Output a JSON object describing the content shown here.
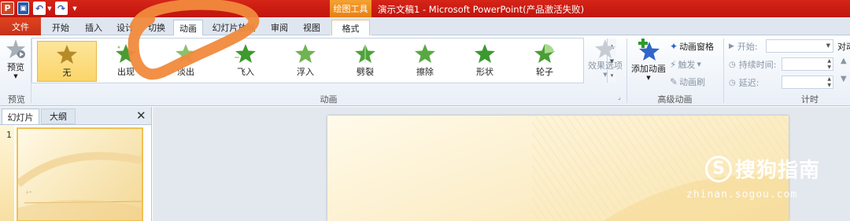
{
  "qat": {
    "app_logo": "P",
    "undo": "↶",
    "redo": "↷"
  },
  "window": {
    "contextual_group": "绘图工具",
    "title": "演示文稿1 - Microsoft PowerPoint(产品激活失败)"
  },
  "tabs": {
    "file": "文件",
    "items": [
      "开始",
      "插入",
      "设计",
      "切换",
      "动画",
      "幻灯片放映",
      "审阅",
      "视图"
    ],
    "active": "动画",
    "format": "格式"
  },
  "ribbon": {
    "preview": {
      "label": "预览",
      "group": "预览"
    },
    "animation_group": "动画",
    "gallery": [
      "无",
      "出现",
      "淡出",
      "飞入",
      "浮入",
      "劈裂",
      "擦除",
      "形状",
      "轮子"
    ],
    "selected": "无",
    "effect_options": "效果选项",
    "advanced": {
      "group": "高级动画",
      "add_animation": "添加动画",
      "animation_pane": "动画窗格",
      "trigger": "触发",
      "animation_painter": "动画刷"
    },
    "timing": {
      "group": "计时",
      "start": "开始:",
      "duration": "持续时间:",
      "delay": "延迟:",
      "reorder": "对动"
    }
  },
  "slide_pane": {
    "tab_slides": "幻灯片",
    "tab_outline": "大纲",
    "close": "✕",
    "slide_number": "1"
  },
  "watermark": {
    "logo": "S",
    "text": "搜狗指南",
    "url": "zhinan.sogou.com"
  },
  "colors": {
    "title_bar": "#c8180f",
    "file_tab": "#d13b1a",
    "contextual": "#f08a1c",
    "selected_gallery": "#fbd56a",
    "scribble": "#f08a3c"
  }
}
